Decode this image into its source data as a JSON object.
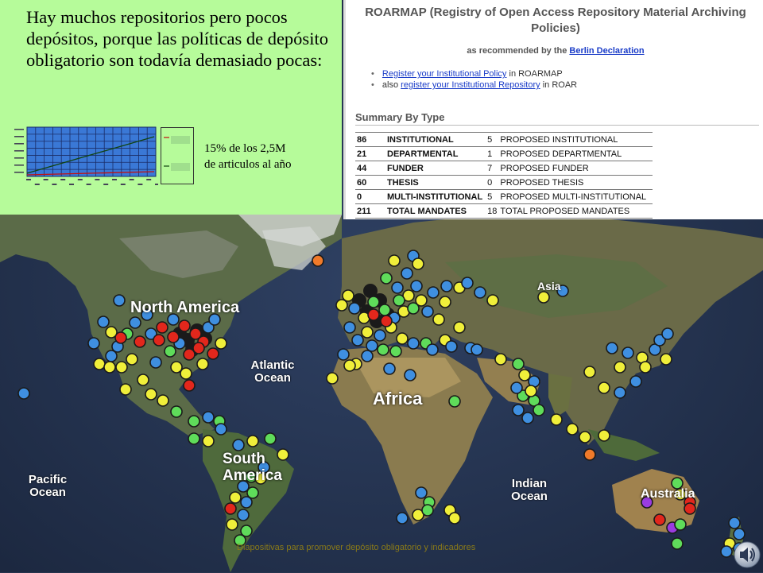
{
  "slide": {
    "headline": "Hay muchos repositorios pero pocos depósitos, porque las políticas de depósito obligatorio son todavía demasiado pocas:",
    "stat_line1": "15% de los 2,5M",
    "stat_line2": "de articulos al año",
    "footer": "Diapositivas para promover depósito obligatorio y indicadores"
  },
  "roarmap": {
    "title": "ROARMAP (Registry of Open Access Repository Material Archiving Policies)",
    "subtitle_prefix": "as recommended by the",
    "subtitle_link": "Berlin Declaration",
    "bullets": [
      {
        "link": "Register your Institutional Policy",
        "suffix": " in ROARMAP",
        "prefix": ""
      },
      {
        "prefix": "also ",
        "link": "register your Institutional Repository",
        "suffix": " in ROAR"
      }
    ],
    "summary_heading": "Summary By Type",
    "rows": [
      {
        "count": "86",
        "type": "INSTITUTIONAL",
        "pcount": "5",
        "ptype": "PROPOSED INSTITUTIONAL"
      },
      {
        "count": "21",
        "type": "DEPARTMENTAL",
        "pcount": "1",
        "ptype": "PROPOSED DEPARTMENTAL"
      },
      {
        "count": "44",
        "type": "FUNDER",
        "pcount": "7",
        "ptype": "PROPOSED FUNDER"
      },
      {
        "count": "60",
        "type": "THESIS",
        "pcount": "0",
        "ptype": "PROPOSED THESIS"
      },
      {
        "count": "0",
        "type": "MULTI-INSTITUTIONAL",
        "pcount": "5",
        "ptype": "PROPOSED MULTI-INSTITUTIONAL"
      },
      {
        "count": "211",
        "type": "TOTAL MANDATES",
        "pcount": "18",
        "ptype": "TOTAL PROPOSED MANDATES"
      }
    ]
  },
  "map": {
    "labels": {
      "north_america": "North America",
      "atlantic": "Atlantic Ocean",
      "africa": "Africa",
      "asia": "Asia",
      "south_america": "South America",
      "pacific": "Pacific Ocean",
      "indian": "Indian Ocean",
      "australia": "Australia"
    },
    "colors": {
      "blue": "#3f8fe0",
      "yellow": "#f0ef3a",
      "green": "#5fdc5a",
      "red": "#e2271c",
      "orange": "#f07a2a",
      "purple": "#9a3ce0"
    }
  },
  "icons": {
    "speaker": "speaker-icon"
  }
}
